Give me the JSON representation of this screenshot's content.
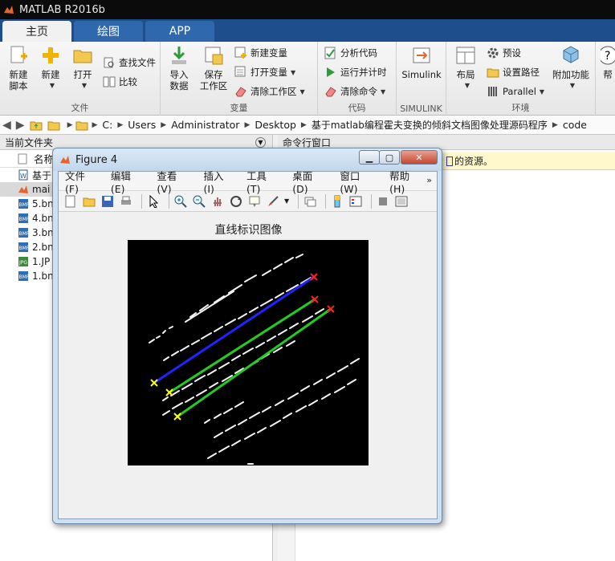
{
  "app": {
    "title": "MATLAB R2016b"
  },
  "tabs": [
    {
      "label": "主页",
      "active": true
    },
    {
      "label": "绘图",
      "active": false
    },
    {
      "label": "APP",
      "active": false
    }
  ],
  "ribbon": {
    "file_group": {
      "label": "文件",
      "new_script": "新建\n脚本",
      "new": "新建",
      "open": "打开",
      "find_files": "查找文件",
      "compare": "比较"
    },
    "variable_group": {
      "label": "变量",
      "import": "导入\n数据",
      "save_ws": "保存\n工作区",
      "new_var": "新建变量",
      "open_var": "打开变量",
      "clear_ws": "清除工作区"
    },
    "code_group": {
      "label": "代码",
      "analyze": "分析代码",
      "run_time": "运行并计时",
      "clear_cmd": "清除命令"
    },
    "simulink_group": {
      "label": "SIMULINK",
      "simulink": "Simulink"
    },
    "env_group": {
      "label": "环境",
      "layout": "布局",
      "prefs": "预设",
      "set_path": "设置路径",
      "parallel": "Parallel",
      "addons": "附加功能",
      "help": "帮"
    }
  },
  "address": {
    "crumbs": [
      "C:",
      "Users",
      "Administrator",
      "Desktop",
      "基于matlab编程霍夫变换的倾斜文档图像处理源码程序",
      "code"
    ]
  },
  "current_folder": {
    "title": "当前文件夹",
    "column": "名称",
    "files": [
      {
        "name": "基于",
        "type": "doc"
      },
      {
        "name": "mai",
        "type": "m"
      },
      {
        "name": "5.bn",
        "type": "bmp"
      },
      {
        "name": "4.bn",
        "type": "bmp"
      },
      {
        "name": "3.bn",
        "type": "bmp"
      },
      {
        "name": "2.bn",
        "type": "bmp"
      },
      {
        "name": "1.JP",
        "type": "jpg"
      },
      {
        "name": "1.bn",
        "type": "bmp"
      }
    ]
  },
  "command_window": {
    "title": "命令行窗口",
    "info_tail": "的资源。"
  },
  "figure": {
    "title": "Figure 4",
    "menu": [
      "文件(F)",
      "编辑(E)",
      "查看(V)",
      "插入(I)",
      "工具(T)",
      "桌面(D)",
      "窗口(W)",
      "帮助(H)"
    ],
    "plot_title": "直线标识图像",
    "lines": [
      {
        "color": "#2222ff"
      },
      {
        "color": "#22cc22"
      },
      {
        "color": "#22cc22"
      }
    ]
  },
  "colors": {
    "matlab_tab_bar": "#1e4f8c",
    "titlebar": "#0b0b0b",
    "endpoint_start": "#ffff00",
    "endpoint_end": "#ff2020"
  }
}
